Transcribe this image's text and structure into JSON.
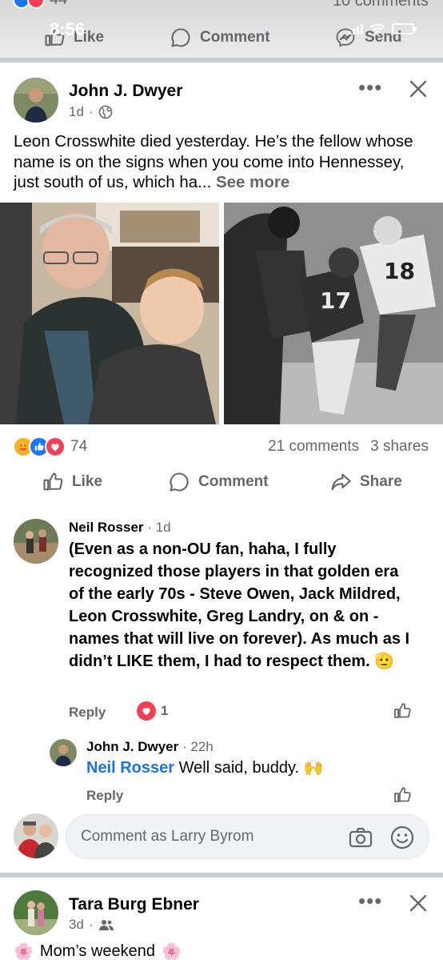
{
  "status_bar": {
    "time": "8:56"
  },
  "previous_post": {
    "reaction_count": "44",
    "comments_label": "10 comments",
    "actions": {
      "like": "Like",
      "comment": "Comment",
      "send": "Send"
    }
  },
  "post": {
    "author": "John J. Dwyer",
    "time": "1d",
    "audience_icon": "globe-icon",
    "text": "Leon Crosswhite died yesterday. He’s the fellow whose name is on the signs when you come into Hennessey, just south of us, which ha...",
    "see_more": "See more",
    "reaction_count": "74",
    "comments_label": "21 comments",
    "shares_label": "3 shares",
    "actions": {
      "like": "Like",
      "comment": "Comment",
      "share": "Share"
    }
  },
  "comments": [
    {
      "author": "Neil Rosser",
      "time": "1d",
      "text": "(Even as a non-OU fan, haha, I fully recognized those players in that golden era of the early 70s - Steve Owen, Jack Mildred, Leon Crosswhite, Greg Landry, on & on - names that will live on forever). As much as I didn’t LIKE them, I had to respect them.",
      "emoji": "🫡",
      "reply_label": "Reply",
      "reaction_count": "1"
    }
  ],
  "reply": {
    "author": "John J. Dwyer",
    "time": "22h",
    "mention": "Neil Rosser",
    "text": "Well said, buddy.",
    "emoji": "🙌",
    "reply_label": "Reply"
  },
  "composer": {
    "placeholder": "Comment as Larry Byrom"
  },
  "next_post": {
    "author": "Tara Burg Ebner",
    "time": "3d",
    "audience_icon": "friends-icon",
    "text": "Mom’s weekend",
    "emoji": "🌸"
  },
  "colors": {
    "link_blue": "#1b74e4",
    "secondary_text": "#65676b",
    "like_blue": "#1877f2",
    "love_red": "#f33e58",
    "care_yellow": "#f7b125"
  }
}
